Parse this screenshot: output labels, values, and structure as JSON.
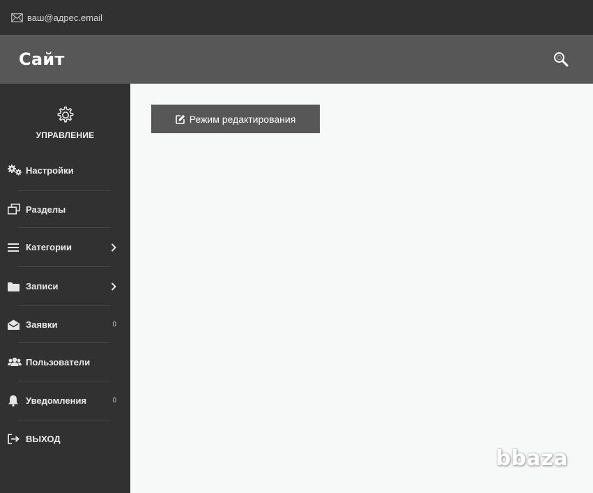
{
  "topbar": {
    "email": "ваш@адрес.email",
    "icon": "envelope-icon"
  },
  "header": {
    "title": "Сайт",
    "search_icon": "search-icon"
  },
  "sidebar": {
    "manage_label": "УПРАВЛЕНИЕ",
    "items": [
      {
        "label": "Настройки",
        "icon": "gears-icon"
      },
      {
        "label": "Разделы",
        "icon": "windows-icon"
      },
      {
        "label": "Категории",
        "icon": "list-icon",
        "has_arrow": true
      },
      {
        "label": "Записи",
        "icon": "folder-icon",
        "has_arrow": true
      },
      {
        "label": "Заявки",
        "icon": "envelope-open-icon",
        "count": "0"
      },
      {
        "label": "Пользователи",
        "icon": "users-icon"
      },
      {
        "label": "Уведомления",
        "icon": "bell-icon",
        "count": "0"
      },
      {
        "label": "ВЫХОД",
        "icon": "sign-out-icon"
      }
    ]
  },
  "main": {
    "edit_button_label": "Режим редактирования"
  },
  "watermark": "bbaza",
  "colors": {
    "topbar": "#313131",
    "header": "#575757",
    "sidebar": "#313131",
    "content": "#f7f9f8",
    "button": "#575757"
  }
}
